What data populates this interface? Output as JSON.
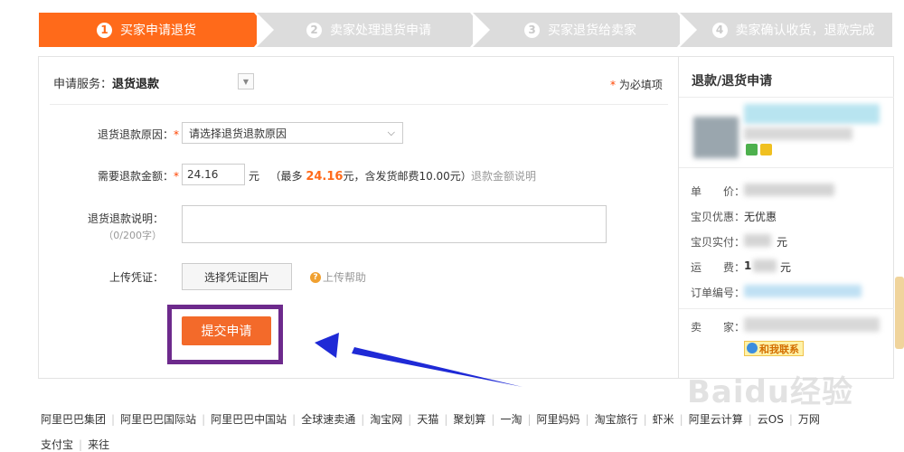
{
  "steps": [
    {
      "num": "1",
      "label": "买家申请退货"
    },
    {
      "num": "2",
      "label": "卖家处理退货申请"
    },
    {
      "num": "3",
      "label": "买家退货给卖家"
    },
    {
      "num": "4",
      "label": "卖家确认收货，退款完成"
    }
  ],
  "form": {
    "service_label": "申请服务：",
    "service_value": "退货退款",
    "required_note": "为必填项",
    "reason_label": "退货退款原因：",
    "reason_value": "请选择退货退款原因",
    "amount_label": "需要退款金额：",
    "amount_value": "24.16",
    "amount_unit": "元",
    "amount_hint_prefix": "（最多",
    "amount_max": "24.16",
    "amount_hint_suffix": "元，含发货邮费10.00元）",
    "amount_help_link": "退款金额说明",
    "desc_label": "退货退款说明：",
    "desc_counter": "（0/200字）",
    "upload_label": "上传凭证：",
    "upload_button": "选择凭证图片",
    "upload_help": "上传帮助",
    "submit_button": "提交申请"
  },
  "sidebar": {
    "title": "退款/退货申请",
    "unit_price_label": "单　　价：",
    "discount_label": "宝贝优惠：",
    "discount_value": "无优惠",
    "paid_label": "宝贝实付：",
    "paid_value_suffix": "元",
    "shipping_label": "运　　费：",
    "shipping_value_prefix": "1",
    "shipping_value_suffix": "元",
    "order_no_label": "订单编号：",
    "seller_label": "卖　　家：",
    "contact_label": "和我联系"
  },
  "footer": {
    "links": [
      "阿里巴巴集团",
      "阿里巴巴国际站",
      "阿里巴巴中国站",
      "全球速卖通",
      "淘宝网",
      "天猫",
      "聚划算",
      "一淘",
      "阿里妈妈",
      "淘宝旅行",
      "虾米",
      "阿里云计算",
      "云OS",
      "万网"
    ],
    "links_row2": [
      "支付宝",
      "来往"
    ]
  },
  "watermark": "Baidu经验",
  "colors": {
    "accent": "#ff6a1a",
    "step_inactive": "#dcdcdc",
    "highlight_frame": "#6d2a8c",
    "arrow": "#1f2ad6"
  }
}
